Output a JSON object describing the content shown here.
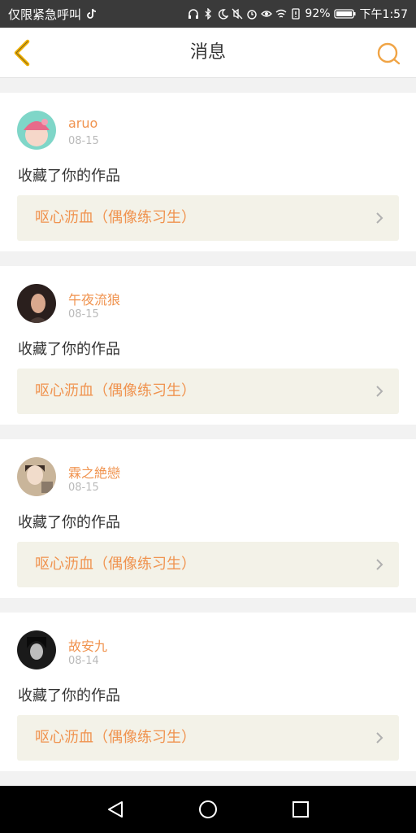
{
  "status_bar": {
    "carrier": "仅限紧急呼叫",
    "battery": "92%",
    "time": "下午1:57"
  },
  "header": {
    "title": "消息",
    "back_icon": "chevron-left-icon",
    "search_icon": "search-icon",
    "accent": "#f0a445"
  },
  "notifications": [
    {
      "user": "aruo",
      "date": "08-15",
      "action": "收藏了你的作品",
      "work": "呕心沥血（偶像练习生）"
    },
    {
      "user": "午夜流狼",
      "date": "08-15",
      "action": "收藏了你的作品",
      "work": "呕心沥血（偶像练习生）"
    },
    {
      "user": "霖之絶戀",
      "date": "08-15",
      "action": "收藏了你的作品",
      "work": "呕心沥血（偶像练习生）"
    },
    {
      "user": "故安九",
      "date": "08-14",
      "action": "收藏了你的作品",
      "work": "呕心沥血（偶像练习生）"
    }
  ],
  "colors": {
    "username": "#f0934f",
    "work_bg": "#f3f2e8",
    "date": "#b9b9b9"
  }
}
